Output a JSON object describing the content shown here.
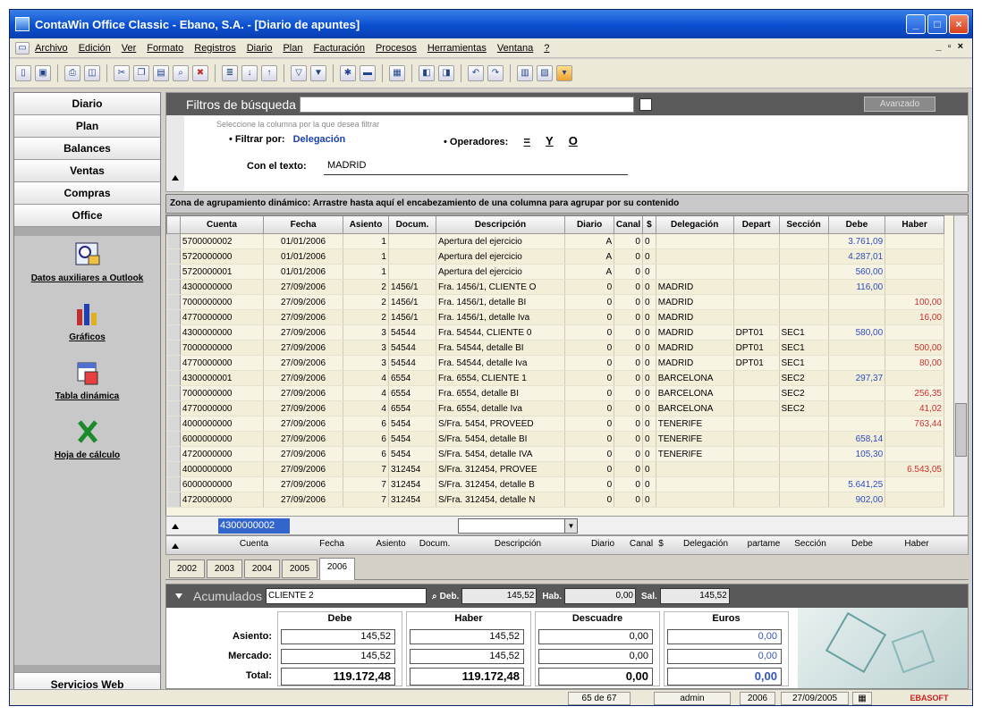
{
  "window": {
    "title": "ContaWin Office Classic - Ebano, S.A. - [Diario de apuntes]"
  },
  "menu": {
    "items": [
      "Archivo",
      "Edición",
      "Ver",
      "Formato",
      "Registros",
      "Diario",
      "Plan",
      "Facturación",
      "Procesos",
      "Herramientas",
      "Ventana",
      "?"
    ],
    "window_controls": "_ ▫ ×"
  },
  "leftnav": {
    "buttons": [
      "Diario",
      "Plan",
      "Balances",
      "Ventas",
      "Compras",
      "Office"
    ],
    "tools": [
      "Datos auxiliares a Outlook",
      "Gráficos",
      "Tabla dinámica",
      "Hoja de cálculo"
    ],
    "web_button": "Servicios Web"
  },
  "filters": {
    "title": "Filtros de búsqueda",
    "advanced_button": "Avanzado",
    "hint": "Seleccione la columna por la que desea filtrar",
    "filter_by_label": "• Filtrar por:",
    "filter_by_value": "Delegación",
    "operators_label": "• Operadores:",
    "operators": [
      "=",
      "Y",
      "O"
    ],
    "text_label": "Con el texto:",
    "text_value": "MADRID"
  },
  "grid": {
    "group_band": "Zona de agrupamiento dinámico: Arrastre hasta aquí el encabezamiento de una columna para agrupar por su contenido",
    "columns": [
      "",
      "Cuenta",
      "Fecha",
      "Asiento",
      "Docum.",
      "Descripción",
      "Diario",
      "Canal",
      "$",
      "Delegación",
      "Depart",
      "Sección",
      "Debe",
      "Haber"
    ],
    "rows": [
      [
        "5700000002",
        "01/01/2006",
        "1",
        "",
        "Apertura del ejercicio",
        "A",
        "0",
        "0",
        "",
        "",
        "",
        "3.761,09",
        ""
      ],
      [
        "5720000000",
        "01/01/2006",
        "1",
        "",
        "Apertura del ejercicio",
        "A",
        "0",
        "0",
        "",
        "",
        "",
        "4.287,01",
        ""
      ],
      [
        "5720000001",
        "01/01/2006",
        "1",
        "",
        "Apertura del ejercicio",
        "A",
        "0",
        "0",
        "",
        "",
        "",
        "560,00",
        ""
      ],
      [
        "4300000000",
        "27/09/2006",
        "2",
        "1456/1",
        "Fra. 1456/1, CLIENTE O",
        "0",
        "0",
        "0",
        "MADRID",
        "",
        "",
        "116,00",
        ""
      ],
      [
        "7000000000",
        "27/09/2006",
        "2",
        "1456/1",
        "Fra. 1456/1, detalle BI",
        "0",
        "0",
        "0",
        "MADRID",
        "",
        "",
        "",
        "100,00"
      ],
      [
        "4770000000",
        "27/09/2006",
        "2",
        "1456/1",
        "Fra. 1456/1, detalle Iva",
        "0",
        "0",
        "0",
        "MADRID",
        "",
        "",
        "",
        "16,00"
      ],
      [
        "4300000000",
        "27/09/2006",
        "3",
        "54544",
        "Fra. 54544, CLIENTE 0",
        "0",
        "0",
        "0",
        "MADRID",
        "DPT01",
        "SEC1",
        "580,00",
        ""
      ],
      [
        "7000000000",
        "27/09/2006",
        "3",
        "54544",
        "Fra. 54544, detalle BI",
        "0",
        "0",
        "0",
        "MADRID",
        "DPT01",
        "SEC1",
        "",
        "500,00"
      ],
      [
        "4770000000",
        "27/09/2006",
        "3",
        "54544",
        "Fra. 54544, detalle Iva",
        "0",
        "0",
        "0",
        "MADRID",
        "DPT01",
        "SEC1",
        "",
        "80,00"
      ],
      [
        "4300000001",
        "27/09/2006",
        "4",
        "6554",
        "Fra. 6554, CLIENTE 1",
        "0",
        "0",
        "0",
        "BARCELONA",
        "",
        "SEC2",
        "297,37",
        ""
      ],
      [
        "7000000000",
        "27/09/2006",
        "4",
        "6554",
        "Fra. 6554, detalle BI",
        "0",
        "0",
        "0",
        "BARCELONA",
        "",
        "SEC2",
        "",
        "256,35"
      ],
      [
        "4770000000",
        "27/09/2006",
        "4",
        "6554",
        "Fra. 6554, detalle Iva",
        "0",
        "0",
        "0",
        "BARCELONA",
        "",
        "SEC2",
        "",
        "41,02"
      ],
      [
        "4000000000",
        "27/09/2006",
        "6",
        "5454",
        "S/Fra. 5454, PROVEED",
        "0",
        "0",
        "0",
        "TENERIFE",
        "",
        "",
        "",
        "763,44"
      ],
      [
        "6000000000",
        "27/09/2006",
        "6",
        "5454",
        "S/Fra. 5454, detalle BI",
        "0",
        "0",
        "0",
        "TENERIFE",
        "",
        "",
        "658,14",
        ""
      ],
      [
        "4720000000",
        "27/09/2006",
        "6",
        "5454",
        "S/Fra. 5454, detalle IVA",
        "0",
        "0",
        "0",
        "TENERIFE",
        "",
        "",
        "105,30",
        ""
      ],
      [
        "4000000000",
        "27/09/2006",
        "7",
        "312454",
        "S/Fra. 312454, PROVEE",
        "0",
        "0",
        "0",
        "",
        "",
        "",
        "",
        "6.543,05"
      ],
      [
        "6000000000",
        "27/09/2006",
        "7",
        "312454",
        "S/Fra. 312454, detalle B",
        "0",
        "0",
        "0",
        "",
        "",
        "",
        "5.641,25",
        ""
      ],
      [
        "4720000000",
        "27/09/2006",
        "7",
        "312454",
        "S/Fra. 312454, detalle N",
        "0",
        "0",
        "0",
        "",
        "",
        "",
        "902,00",
        ""
      ]
    ],
    "filter_row_cuenta": "4300000002",
    "footer_columns": [
      "Cuenta",
      "Fecha",
      "Asiento",
      "Docum.",
      "Descripción",
      "Diario",
      "Canal",
      "$",
      "Delegación",
      "partame",
      "Sección",
      "Debe",
      "Haber"
    ]
  },
  "year_tabs": {
    "items": [
      "2002",
      "2003",
      "2004",
      "2005",
      "2006"
    ],
    "active": "2006"
  },
  "accumulated": {
    "title": "Acumulados",
    "account_name": "CLIENTE 2",
    "deb_label": "Deb.",
    "deb_value": "145,52",
    "hab_label": "Hab.",
    "hab_value": "0,00",
    "sal_label": "Sal.",
    "sal_value": "145,52",
    "headers": [
      "Debe",
      "Haber",
      "Descuadre",
      "Euros"
    ],
    "rows": [
      {
        "label": "Asiento:",
        "debe": "145,52",
        "haber": "145,52",
        "descuadre": "0,00",
        "euros": "0,00"
      },
      {
        "label": "Mercado:",
        "debe": "145,52",
        "haber": "145,52",
        "descuadre": "0,00",
        "euros": "0,00"
      },
      {
        "label": "Total:",
        "debe": "119.172,48",
        "haber": "119.172,48",
        "descuadre": "0,00",
        "euros": "0,00"
      }
    ]
  },
  "statusbar": {
    "records": "65 de 67",
    "user": "admin",
    "year": "2006",
    "date": "27/09/2005",
    "logo": "EBASOFT"
  }
}
